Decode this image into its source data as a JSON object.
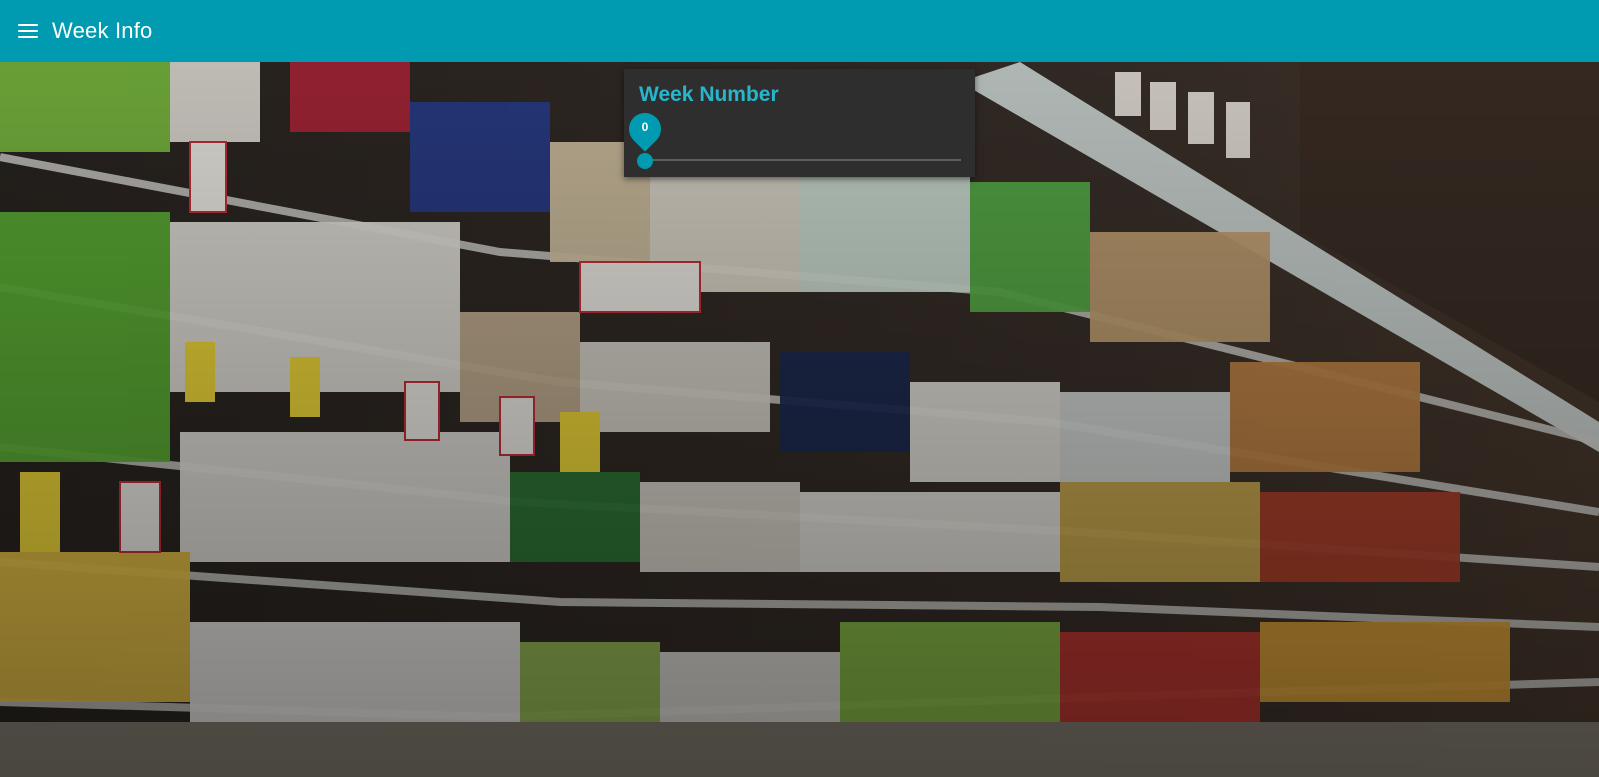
{
  "header": {
    "menu_icon": "hamburger-menu-icon",
    "title": "Week Info"
  },
  "background": {
    "description_icon": "supermarket-dairy-shelves-photo"
  },
  "week_panel": {
    "title": "Week Number",
    "slider": {
      "value": "0",
      "min": 0,
      "max": 52,
      "fraction": 0
    }
  },
  "colors": {
    "accent": "#009bb0",
    "title_accent": "#28b6cc",
    "panel_bg": "#2e2e2e"
  }
}
